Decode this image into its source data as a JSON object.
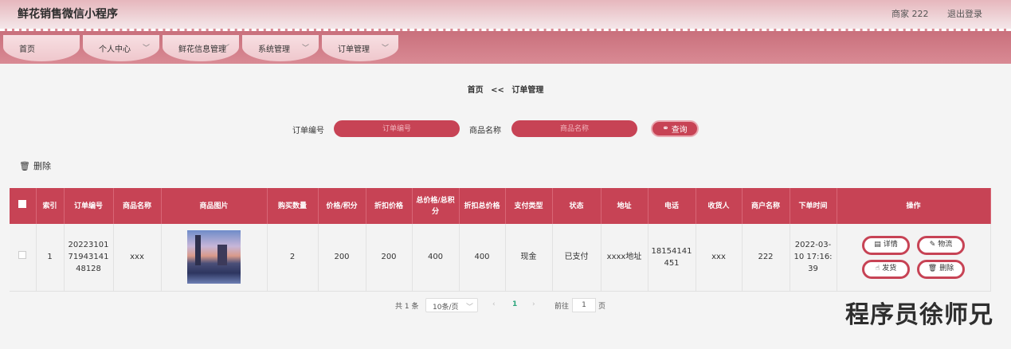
{
  "app": {
    "title": "鲜花销售微信小程序",
    "user": "商家 222",
    "logout": "退出登录"
  },
  "nav": [
    {
      "label": "首页",
      "has_dropdown": false
    },
    {
      "label": "个人中心",
      "has_dropdown": true
    },
    {
      "label": "鲜花信息管理",
      "has_dropdown": true
    },
    {
      "label": "系统管理",
      "has_dropdown": true
    },
    {
      "label": "订单管理",
      "has_dropdown": true
    }
  ],
  "breadcrumb": {
    "home": "首页",
    "sep": "<<",
    "current": "订单管理"
  },
  "search": {
    "order_label": "订单编号",
    "order_placeholder": "订单编号",
    "product_label": "商品名称",
    "product_placeholder": "商品名称",
    "button": "查询"
  },
  "bulk_delete": "删除",
  "table": {
    "headers": [
      "",
      "索引",
      "订单编号",
      "商品名称",
      "商品图片",
      "购买数量",
      "价格/积分",
      "折扣价格",
      "总价格/总积分",
      "折扣总价格",
      "支付类型",
      "状态",
      "地址",
      "电话",
      "收货人",
      "商户名称",
      "下单时间",
      "操作"
    ],
    "rows": [
      {
        "index": "1",
        "order_no": "202231017194314148128",
        "product": "xxx",
        "qty": "2",
        "price": "200",
        "discount_price": "200",
        "total": "400",
        "discount_total": "400",
        "pay_type": "现金",
        "status": "已支付",
        "address": "xxxx地址",
        "phone": "18154141451",
        "receiver": "xxx",
        "merchant": "222",
        "time": "2022-03-10 17:16:39"
      }
    ],
    "actions": {
      "detail": "详情",
      "logistics": "物流",
      "ship": "发货",
      "delete": "删除"
    }
  },
  "pager": {
    "total": "共 1 条",
    "page_size": "10条/页",
    "current": "1",
    "goto_label": "前往",
    "goto_value": "1",
    "page_unit": "页"
  },
  "watermark": "程序员徐师兄",
  "colors": {
    "accent": "#c74355",
    "nav": "#d07c87"
  }
}
